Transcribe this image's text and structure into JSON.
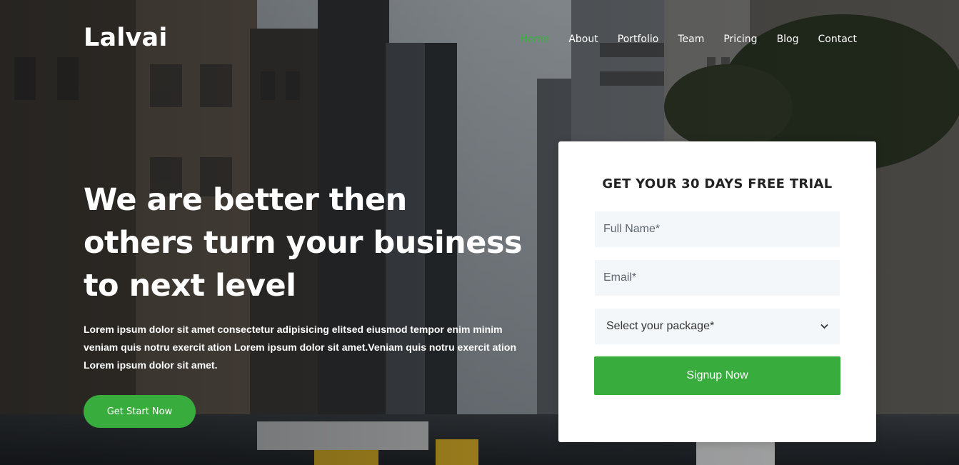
{
  "brand": {
    "logo": "Lalvai"
  },
  "nav": {
    "items": [
      {
        "label": "Home",
        "active": true
      },
      {
        "label": "About"
      },
      {
        "label": "Portfolio"
      },
      {
        "label": "Team"
      },
      {
        "label": "Pricing"
      },
      {
        "label": "Blog"
      },
      {
        "label": "Contact"
      }
    ]
  },
  "hero": {
    "headline_line1": "We are better then",
    "headline_line2": "others turn your business",
    "headline_line3": "to next level",
    "lead": "Lorem ipsum dolor sit amet consectetur adipisicing elitsed eiusmod tempor enim minim veniam quis notru exercit ation Lorem ipsum dolor sit amet.Veniam quis notru exercit ation Lorem ipsum dolor sit amet.",
    "cta_label": "Get Start Now"
  },
  "form": {
    "title": "GET YOUR 30 DAYS FREE TRIAL",
    "full_name_placeholder": "Full Name*",
    "email_placeholder": "Email*",
    "package_selected": "Select your package*",
    "submit_label": "Signup Now"
  },
  "colors": {
    "accent": "#38ac3c",
    "field_bg": "#f4f7fa",
    "card_bg": "#ffffff"
  }
}
